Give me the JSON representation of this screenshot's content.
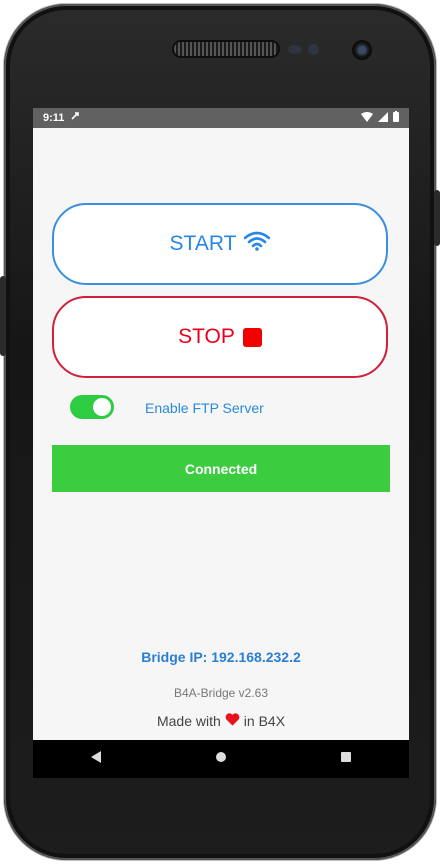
{
  "status": {
    "time": "9:11"
  },
  "start_button": {
    "label": "START"
  },
  "stop_button": {
    "label": "STOP"
  },
  "ftp_toggle": {
    "label": "Enable FTP Server",
    "on": true
  },
  "connection_status": {
    "label": "Connected"
  },
  "footer": {
    "bridge_ip": "Bridge IP: 192.168.232.2",
    "version": "B4A-Bridge v2.63",
    "made_prefix": "Made with",
    "made_suffix": "in B4X"
  },
  "colors": {
    "accent_blue": "#2787e8",
    "stop_red": "#e8001a",
    "connected_green": "#3bcc40"
  },
  "icons": {
    "start": "wifi-icon",
    "stop": "stop-square-icon",
    "love": "heart-icon"
  }
}
